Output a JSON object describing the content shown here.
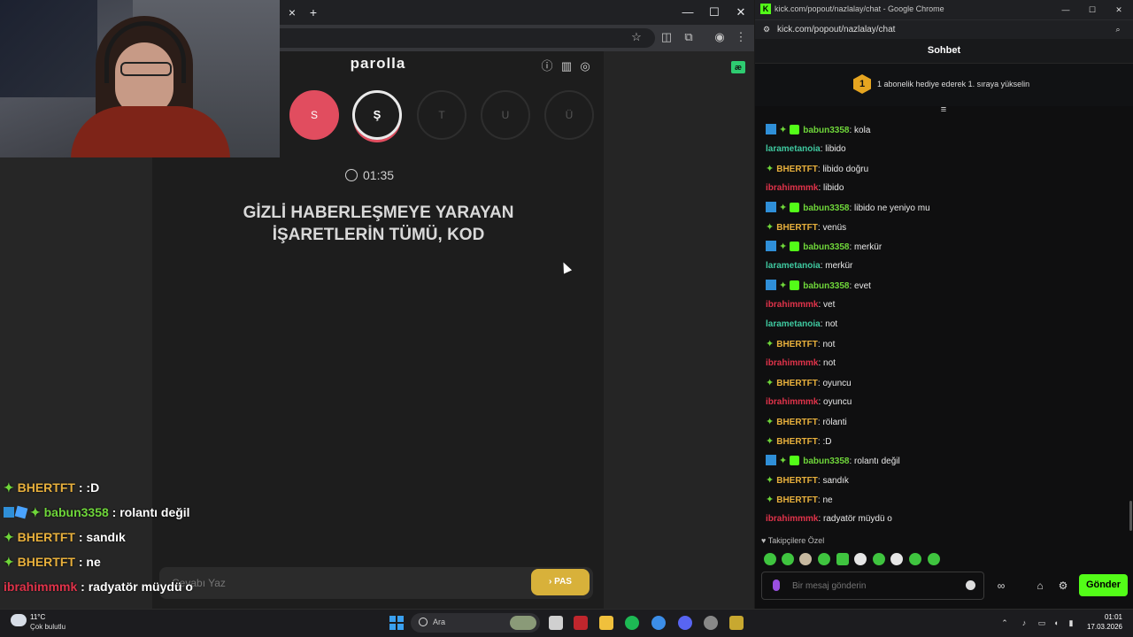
{
  "left_browser": {
    "tab_close": "×",
    "tab_new": "+",
    "window_controls": {
      "minimize": "—",
      "maximize": "☐",
      "close": "✕"
    }
  },
  "game": {
    "title": "parolla",
    "letters": [
      {
        "label": "S",
        "state": "done"
      },
      {
        "label": "Ş",
        "state": "active"
      },
      {
        "label": "T",
        "state": "pending"
      },
      {
        "label": "U",
        "state": "pending"
      },
      {
        "label": "Ü",
        "state": "pending"
      }
    ],
    "timer": "01:35",
    "question_line1": "GİZLİ HABERLEŞMEYE YARAYAN",
    "question_line2": "İŞARETLERİN TÜMÜ, KOD",
    "answer_placeholder": "Cevabı Yaz",
    "pass_label": "PAS",
    "badge": "æ"
  },
  "overlay_chat": [
    {
      "user": "BHERTFT",
      "text": ":D",
      "color": "#e8b03c",
      "badges": [
        "spark"
      ]
    },
    {
      "user": "babun3358",
      "text": "rolantı değil",
      "color": "#6fd63a",
      "badges": [
        "mod",
        "cube",
        "spark"
      ]
    },
    {
      "user": "BHERTFT",
      "text": "sandık",
      "color": "#e8b03c",
      "badges": [
        "spark"
      ]
    },
    {
      "user": "BHERTFT",
      "text": "ne",
      "color": "#e8b03c",
      "badges": [
        "spark"
      ]
    },
    {
      "user": "ibrahimmmk",
      "text": "radyatör müydü o",
      "color": "#e0334a",
      "badges": []
    }
  ],
  "chat_window": {
    "title": "kick.com/popout/nazlalay/chat - Google Chrome",
    "url": "kick.com/popout/nazlalay/chat",
    "header": "Sohbet",
    "gift_rank": "1",
    "gift_text": "1 abonelik hediye ederek 1. sıraya yükselin",
    "messages": [
      {
        "user": "babun3358",
        "text": "kola",
        "color": "#6fd63a",
        "badges": [
          "mod",
          "spark",
          "sub"
        ]
      },
      {
        "user": "larametanoia",
        "text": "libido",
        "color": "#3fc9a0",
        "badges": []
      },
      {
        "user": "BHERTFT",
        "text": "libido doğru",
        "color": "#e8b03c",
        "badges": [
          "spark"
        ]
      },
      {
        "user": "ibrahimmmk",
        "text": "libido",
        "color": "#e0334a",
        "badges": []
      },
      {
        "user": "babun3358",
        "text": "libido ne yeniyo mu",
        "color": "#6fd63a",
        "badges": [
          "mod",
          "spark",
          "sub"
        ]
      },
      {
        "user": "BHERTFT",
        "text": "venüs",
        "color": "#e8b03c",
        "badges": [
          "spark"
        ]
      },
      {
        "user": "babun3358",
        "text": "merkür",
        "color": "#6fd63a",
        "badges": [
          "mod",
          "spark",
          "sub"
        ]
      },
      {
        "user": "larametanoia",
        "text": "merkür",
        "color": "#3fc9a0",
        "badges": []
      },
      {
        "user": "babun3358",
        "text": "evet",
        "color": "#6fd63a",
        "badges": [
          "mod",
          "spark",
          "sub"
        ]
      },
      {
        "user": "ibrahimmmk",
        "text": "vet",
        "color": "#e0334a",
        "badges": []
      },
      {
        "user": "larametanoia",
        "text": "not",
        "color": "#3fc9a0",
        "badges": []
      },
      {
        "user": "BHERTFT",
        "text": "not",
        "color": "#e8b03c",
        "badges": [
          "spark"
        ]
      },
      {
        "user": "ibrahimmmk",
        "text": "not",
        "color": "#e0334a",
        "badges": []
      },
      {
        "user": "BHERTFT",
        "text": "oyuncu",
        "color": "#e8b03c",
        "badges": [
          "spark"
        ]
      },
      {
        "user": "ibrahimmmk",
        "text": "oyuncu",
        "color": "#e0334a",
        "badges": []
      },
      {
        "user": "BHERTFT",
        "text": "rölanti",
        "color": "#e8b03c",
        "badges": [
          "spark"
        ]
      },
      {
        "user": "BHERTFT",
        "text": ":D",
        "color": "#e8b03c",
        "badges": [
          "spark"
        ]
      },
      {
        "user": "babun3358",
        "text": "rolantı değil",
        "color": "#6fd63a",
        "badges": [
          "mod",
          "spark",
          "sub"
        ]
      },
      {
        "user": "BHERTFT",
        "text": "sandık",
        "color": "#e8b03c",
        "badges": [
          "spark"
        ]
      },
      {
        "user": "BHERTFT",
        "text": "ne",
        "color": "#e8b03c",
        "badges": [
          "spark"
        ]
      },
      {
        "user": "ibrahimmmk",
        "text": "radyatör müydü o",
        "color": "#e0334a",
        "badges": []
      }
    ],
    "followers_only_label": "Takipçilere Özel",
    "input_placeholder": "Bir mesaj gönderin",
    "send_label": "Gönder"
  },
  "taskbar": {
    "temperature": "11°C",
    "weather": "Çok bulutlu",
    "search_label": "Ara",
    "time": "01:01",
    "date": "17.03.2026"
  },
  "colors": {
    "accent_green": "#53fc18",
    "done_red": "#e14d5f",
    "pass_gold": "#d8b13a"
  }
}
